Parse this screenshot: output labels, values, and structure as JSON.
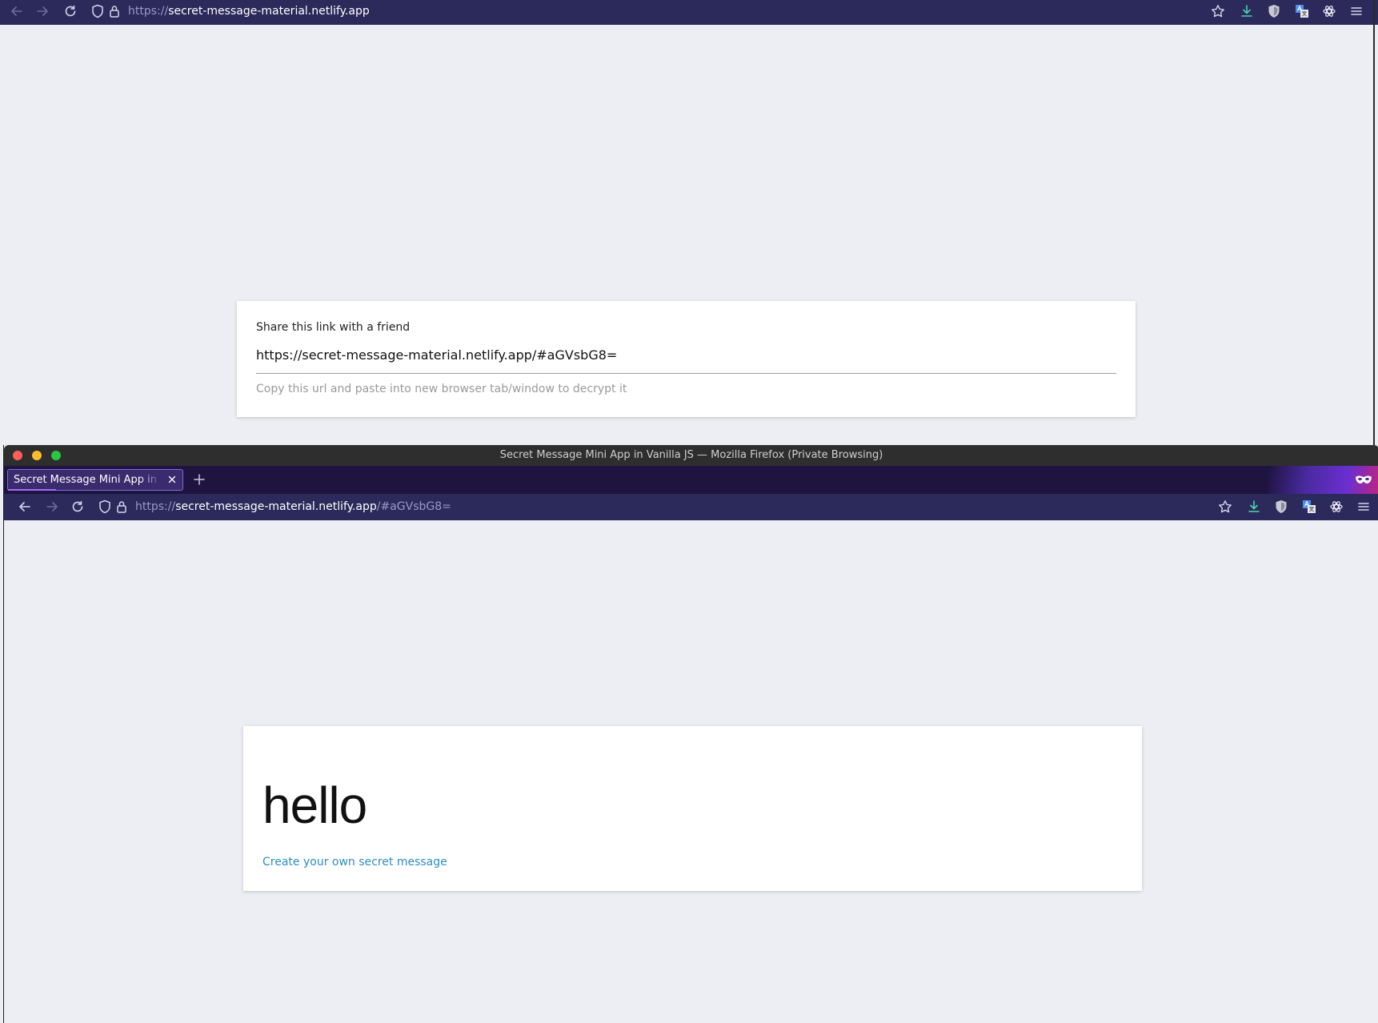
{
  "back_window": {
    "url": {
      "scheme": "https://",
      "host": "secret-message-material.netlify.app",
      "rest": ""
    },
    "card": {
      "label": "Share this link with a friend",
      "link_value": "https://secret-message-material.netlify.app/#aGVsbG8=",
      "hint": "Copy this url and paste into new browser tab/window to decrypt it"
    }
  },
  "front_window": {
    "title": "Secret Message Mini App in Vanilla JS — Mozilla Firefox (Private Browsing)",
    "tab": {
      "label": "Secret Message Mini App in Vanilla JS"
    },
    "url": {
      "scheme": "https://",
      "host": "secret-message-material.netlify.app",
      "rest": "/#aGVsbG8="
    },
    "card": {
      "message": "hello",
      "create_link": "Create your own secret message"
    }
  },
  "colors": {
    "toolbar_bg": "#2b2a5a",
    "tabstrip_bg": "#1f1440",
    "page_bg": "#eceef3",
    "link": "#2d8fbf",
    "close_light": "#ff5f57",
    "minimize_light": "#febc2e",
    "zoom_light": "#28c840"
  },
  "icons": [
    "back-arrow-icon",
    "forward-arrow-icon",
    "reload-icon",
    "shield-icon",
    "lock-icon",
    "star-icon",
    "download-icon",
    "ublock-shield-icon",
    "translate-icon",
    "extension-gear-icon",
    "menu-icon",
    "close-icon",
    "plus-icon",
    "private-mask-icon"
  ]
}
